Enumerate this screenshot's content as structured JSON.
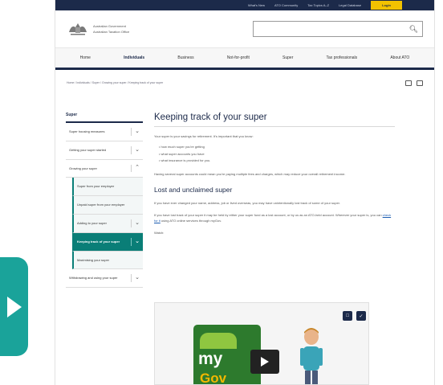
{
  "utility": {
    "links": [
      "What's New",
      "ATO Community",
      "Tax Topics A–Z",
      "Legal Database"
    ],
    "login": "Login"
  },
  "header": {
    "gov_line1": "Australian Government",
    "gov_line2": "Australian Taxation Office"
  },
  "nav": {
    "items": [
      "Home",
      "Individuals",
      "Business",
      "Not-for-profit",
      "Super",
      "Tax professionals",
      "About ATO"
    ],
    "active_index": 1
  },
  "breadcrumb": "Home / Individuals / Super / Growing your super / Keeping track of your super",
  "sidebar": {
    "title": "Super",
    "items": [
      "Super housing measures",
      "Getting your super started",
      "Growing your super",
      "Super from your employer",
      "Unpaid super from your employer",
      "Adding to your super",
      "Keeping track of your super",
      "Maximising your super",
      "Withdrawing and using your super"
    ]
  },
  "content": {
    "title": "Keeping track of your super",
    "intro": "Your super is your savings for retirement. It's important that you know:",
    "bullets": [
      "how much super you're getting",
      "what super accounts you have",
      "what insurance is provided for you."
    ],
    "para2": "Having several super accounts could mean you're paying multiple fees and charges, which may reduce your overall retirement income.",
    "h2": "Lost and unclaimed super",
    "para3": "If you have ever changed your name, address, job or lived overseas, you may have unintentionally lost track of some of your super.",
    "para4_start": "If you have lost track of your super it may be held by either your super fund as a lost account, or by us as an ATO-held account. Wherever your super is, you can ",
    "para4_link": "check for it",
    "para4_end": " using ATO online services through myGov.",
    "watch": "Watch:"
  },
  "video": {
    "my": "my",
    "gov": "Gov"
  },
  "colors": {
    "navy": "#1c2a4a",
    "teal": "#0a7e77",
    "accent_play": "#1aa39a",
    "login_yellow": "#f2c200"
  }
}
